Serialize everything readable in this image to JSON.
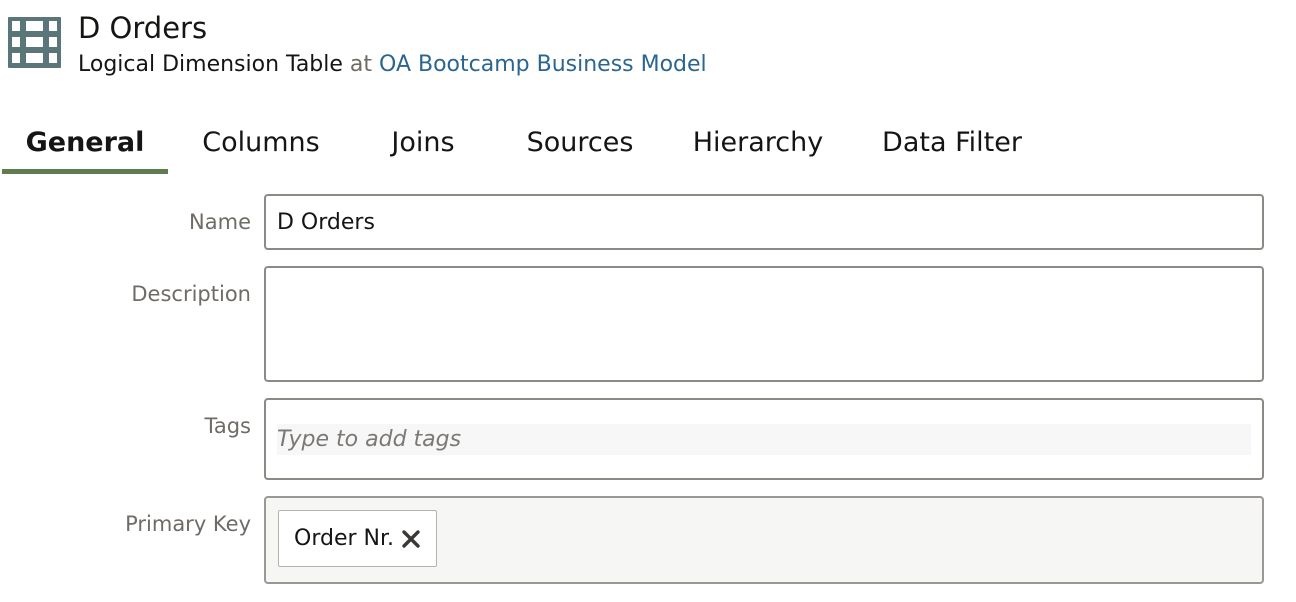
{
  "header": {
    "title": "D Orders",
    "object_type": "Logical Dimension Table",
    "at_text": "at",
    "parent_link": "OA Bootcamp Business Model",
    "icon": "table-icon"
  },
  "tabs": [
    {
      "label": "General",
      "active": true
    },
    {
      "label": "Columns",
      "active": false
    },
    {
      "label": "Joins",
      "active": false
    },
    {
      "label": "Sources",
      "active": false
    },
    {
      "label": "Hierarchy",
      "active": false
    },
    {
      "label": "Data Filter",
      "active": false
    }
  ],
  "form": {
    "name": {
      "label": "Name",
      "value": "D Orders"
    },
    "description": {
      "label": "Description",
      "value": ""
    },
    "tags": {
      "label": "Tags",
      "placeholder": "Type to add tags"
    },
    "primary_key": {
      "label": "Primary Key",
      "chips": [
        {
          "label": "Order Nr.",
          "icon": "close-icon"
        }
      ]
    }
  },
  "colors": {
    "accent_tab_underline": "#5f7d4f",
    "icon_bg": "#5b7678",
    "link": "#2b6691"
  }
}
